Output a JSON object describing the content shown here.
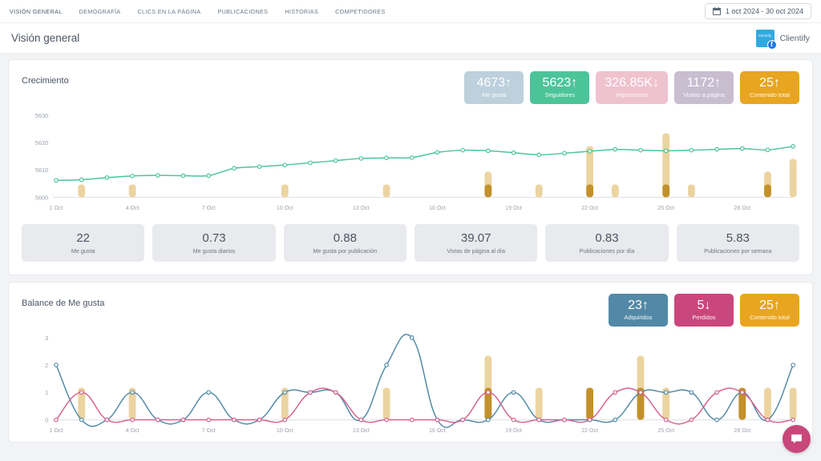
{
  "nav": {
    "items": [
      {
        "label": "VISIÓN GENERAL",
        "active": true
      },
      {
        "label": "DEMOGRAFÍA",
        "active": false
      },
      {
        "label": "CLICS EN LA PÁGINA",
        "active": false
      },
      {
        "label": "PUBLICACIONES",
        "active": false
      },
      {
        "label": "HISTORIAS",
        "active": false
      },
      {
        "label": "COMPETIDORES",
        "active": false
      }
    ],
    "date_range": "1 oct 2024 - 30 oct 2024",
    "calendar_icon": "calendar-icon"
  },
  "header": {
    "title": "Visión general",
    "brand_name": "Clientify",
    "brand_mark_text": "Clientify",
    "facebook_icon": "facebook-icon"
  },
  "growth": {
    "title": "Crecimiento",
    "badges": [
      {
        "value": "4673",
        "arrow": "↑",
        "label": "Me gusta",
        "color": "#bdd0dc"
      },
      {
        "value": "5623",
        "arrow": "↑",
        "label": "Seguidores",
        "color": "#4cc49a"
      },
      {
        "value": "326.85K",
        "arrow": "↓",
        "label": "Impresiones",
        "color": "#efc2cf"
      },
      {
        "value": "1172",
        "arrow": "↑",
        "label": "Visitas a página",
        "color": "#c9bdd0"
      },
      {
        "value": "25",
        "arrow": "↑",
        "label": "Contenido total",
        "color": "#e8a520"
      }
    ],
    "stats": [
      {
        "value": "22",
        "label": "Me gusta"
      },
      {
        "value": "0.73",
        "label": "Me gusta diarios"
      },
      {
        "value": "0.88",
        "label": "Me gusta por publicación"
      },
      {
        "value": "39.07",
        "label": "Vistas de página al día"
      },
      {
        "value": "0.83",
        "label": "Publicaciones por día"
      },
      {
        "value": "5.83",
        "label": "Publicaciones por semana"
      }
    ]
  },
  "balance": {
    "title": "Balance de Me gusta",
    "badges": [
      {
        "value": "23",
        "arrow": "↑",
        "label": "Adquiridos",
        "color": "#5289a6"
      },
      {
        "value": "5",
        "arrow": "↓",
        "label": "Perdidos",
        "color": "#c9477c"
      },
      {
        "value": "25",
        "arrow": "↑",
        "label": "Contenido total",
        "color": "#e8a520"
      }
    ]
  },
  "chat": {
    "icon": "chat-bubble-icon",
    "color": "#c8487c"
  },
  "chart_data": [
    {
      "type": "line",
      "id": "growth-chart",
      "title": "Crecimiento",
      "xlabel": "",
      "ylabel": "",
      "ylim": [
        5600,
        5630
      ],
      "yticks": [
        5600,
        5610,
        5620,
        5630
      ],
      "grid": false,
      "x": [
        "1 Oct",
        "2 Oct",
        "3 Oct",
        "4 Oct",
        "5 Oct",
        "6 Oct",
        "7 Oct",
        "8 Oct",
        "9 Oct",
        "10 Oct",
        "11 Oct",
        "12 Oct",
        "13 Oct",
        "14 Oct",
        "15 Oct",
        "16 Oct",
        "17 Oct",
        "18 Oct",
        "19 Oct",
        "20 Oct",
        "21 Oct",
        "22 Oct",
        "23 Oct",
        "24 Oct",
        "25 Oct",
        "26 Oct",
        "27 Oct",
        "28 Oct",
        "29 Oct",
        "30 Oct"
      ],
      "xtick_labels": [
        "1 Oct",
        "4 Oct",
        "7 Oct",
        "10 Oct",
        "13 Oct",
        "16 Oct",
        "19 Oct",
        "22 Oct",
        "25 Oct",
        "28 Oct"
      ],
      "series": [
        {
          "name": "Seguidores",
          "color": "#4cc49a",
          "values": [
            5606.2,
            5606.4,
            5607.2,
            5607.8,
            5608.0,
            5607.9,
            5607.9,
            5610.6,
            5611.2,
            5611.8,
            5612.6,
            5613.4,
            5614.2,
            5614.4,
            5614.5,
            5616.4,
            5617.2,
            5617.0,
            5616.3,
            5615.5,
            5616.1,
            5616.8,
            5617.5,
            5617.2,
            5617.0,
            5617.2,
            5617.5,
            5617.8,
            5617.3,
            5618.6
          ]
        }
      ],
      "bars": {
        "name": "Contenido publicado",
        "color_light": "#ecd4a0",
        "color_dark": "#c2912b",
        "values": [
          0,
          1,
          0,
          1,
          0,
          0,
          0,
          0,
          0,
          1,
          0,
          0,
          0,
          1,
          0,
          0,
          0,
          2,
          0,
          1,
          0,
          4,
          1,
          0,
          5,
          1,
          0,
          0,
          2,
          3
        ],
        "dark_values": [
          0,
          0,
          0,
          0,
          0,
          0,
          0,
          0,
          0,
          0,
          0,
          0,
          0,
          0,
          0,
          0,
          0,
          1,
          0,
          0,
          0,
          1,
          0,
          0,
          1,
          0,
          0,
          0,
          1,
          0
        ]
      }
    },
    {
      "type": "line",
      "id": "balance-chart",
      "title": "Balance de Me gusta",
      "xlabel": "",
      "ylabel": "",
      "ylim": [
        0,
        3
      ],
      "yticks": [
        0,
        1,
        2,
        3
      ],
      "grid": false,
      "x": [
        "1 Oct",
        "2 Oct",
        "3 Oct",
        "4 Oct",
        "5 Oct",
        "6 Oct",
        "7 Oct",
        "8 Oct",
        "9 Oct",
        "10 Oct",
        "11 Oct",
        "12 Oct",
        "13 Oct",
        "14 Oct",
        "15 Oct",
        "16 Oct",
        "17 Oct",
        "18 Oct",
        "19 Oct",
        "20 Oct",
        "21 Oct",
        "22 Oct",
        "23 Oct",
        "24 Oct",
        "25 Oct",
        "26 Oct",
        "27 Oct",
        "28 Oct",
        "29 Oct",
        "30 Oct"
      ],
      "xtick_labels": [
        "1 Oct",
        "4 Oct",
        "7 Oct",
        "10 Oct",
        "13 Oct",
        "16 Oct",
        "19 Oct",
        "22 Oct",
        "25 Oct",
        "28 Oct"
      ],
      "series": [
        {
          "name": "Adquiridos",
          "color": "#5289a6",
          "values": [
            2,
            0,
            0,
            1,
            0,
            0,
            1,
            0,
            0,
            1,
            1,
            1,
            0,
            2,
            3,
            0,
            0,
            0,
            1,
            0,
            0,
            0,
            0,
            1,
            1,
            1,
            0,
            1,
            0,
            2
          ]
        },
        {
          "name": "Perdidos",
          "color": "#d4628d",
          "values": [
            0,
            1,
            0,
            0,
            0,
            0,
            0,
            0,
            0,
            0,
            1,
            1,
            0,
            0,
            0,
            0,
            0,
            1,
            0,
            0,
            0,
            0,
            1,
            1,
            0,
            0,
            1,
            1,
            0,
            0
          ]
        }
      ],
      "bars": {
        "name": "Contenido publicado",
        "color_light": "#ecd4a0",
        "color_dark": "#c2912b",
        "values": [
          0,
          1,
          0,
          1,
          0,
          0,
          0,
          0,
          0,
          1,
          0,
          0,
          0,
          1,
          0,
          0,
          0,
          2,
          0,
          1,
          0,
          1,
          0,
          2,
          1,
          0,
          0,
          1,
          1,
          1
        ],
        "dark_values": [
          0,
          0,
          0,
          0,
          0,
          0,
          0,
          0,
          0,
          0,
          0,
          0,
          0,
          0,
          0,
          0,
          0,
          1,
          0,
          0,
          0,
          1,
          0,
          1,
          0,
          0,
          0,
          1,
          0,
          0
        ]
      }
    }
  ]
}
